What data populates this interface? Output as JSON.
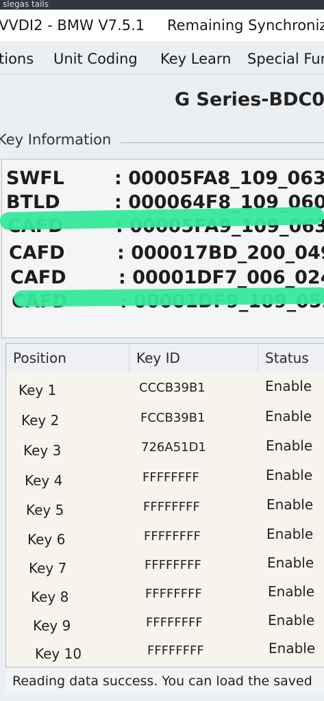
{
  "os_bar": {
    "text": "slegas tails"
  },
  "titlebar": {
    "app_title": "VVDI2 - BMW V7.5.1",
    "sync_text": "Remaining Synchroniz"
  },
  "menu": {
    "items": [
      "tions",
      "Unit Coding",
      "Key Learn",
      "Special Fun"
    ]
  },
  "page": {
    "title": "G Series-BDC0"
  },
  "key_information": {
    "group_label": "Key Information",
    "rows": [
      {
        "key": "SWFL",
        "value": ": 00005FA8_109_063_"
      },
      {
        "key": "BTLD",
        "value": ": 000064F8_109_060_"
      },
      {
        "key": "CAFD",
        "value": ": 00005FA9_109_063_"
      },
      {
        "key": "CAFD",
        "value": ": 000017BD_200_049"
      },
      {
        "key": "CAFD",
        "value": ": 00001DF7_006_024_"
      },
      {
        "key": "CAFD",
        "value": ": 00001DF9_109_052"
      }
    ]
  },
  "key_table": {
    "headers": [
      "Position",
      "Key ID",
      "Status"
    ],
    "rows": [
      {
        "position": "Key 1",
        "key_id": "CCCB39B1",
        "status": "Enable"
      },
      {
        "position": "Key 2",
        "key_id": "FCCB39B1",
        "status": "Enable"
      },
      {
        "position": "Key 3",
        "key_id": "726A51D1",
        "status": "Enable"
      },
      {
        "position": "Key 4",
        "key_id": "FFFFFFFF",
        "status": "Enable"
      },
      {
        "position": "Key 5",
        "key_id": "FFFFFFFF",
        "status": "Enable"
      },
      {
        "position": "Key 6",
        "key_id": "FFFFFFFF",
        "status": "Enable"
      },
      {
        "position": "Key 7",
        "key_id": "FFFFFFFF",
        "status": "Enable"
      },
      {
        "position": "Key 8",
        "key_id": "FFFFFFFF",
        "status": "Enable"
      },
      {
        "position": "Key 9",
        "key_id": "FFFFFFFF",
        "status": "Enable"
      },
      {
        "position": "Key 10",
        "key_id": "FFFFFFFF",
        "status": "Enable"
      }
    ]
  },
  "status_bar": {
    "text": "Reading data success. You can load the saved"
  },
  "colors": {
    "highlighter": "#35e89a",
    "panel_bg": "#f6f4ec",
    "window_bg": "#eceff2"
  }
}
